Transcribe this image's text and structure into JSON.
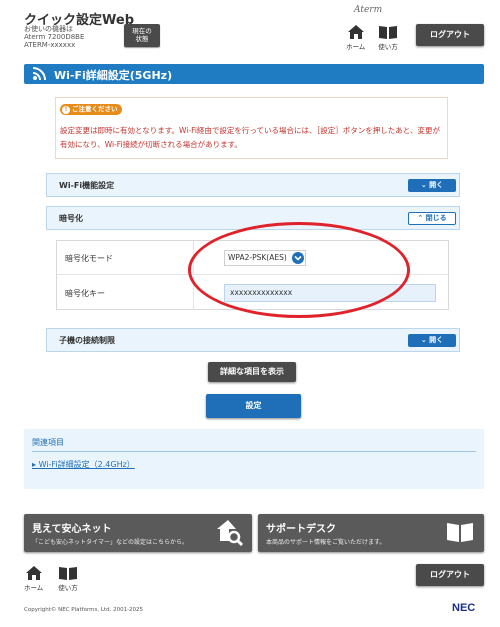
{
  "header": {
    "app_title": "クイック設定Web",
    "device_line1": "お使いの機器は",
    "device_line2": "Aterm 7200D8BE",
    "device_line3": "ATERM-xxxxxx",
    "status_line1": "現在の",
    "status_line2": "状態",
    "brand": "Aterm",
    "home_label": "ホーム",
    "help_label": "使い方",
    "logout_label": "ログアウト"
  },
  "page": {
    "title": "Wi-Fi詳細設定(5GHz)"
  },
  "notice": {
    "badge": "ご注意ください",
    "text": "設定変更は即時に有効となります。Wi-Fi経由で設定を行っている場合には、［設定］ボタンを押したあと、変更が有効になり、Wi-Fi接続が切断される場合があります。"
  },
  "sections": {
    "wifi_function": {
      "label": "Wi-Fi機能設定",
      "toggle": "開く"
    },
    "encryption": {
      "label": "暗号化",
      "toggle": "閉じる"
    },
    "client_limit": {
      "label": "子機の接続制限",
      "toggle": "開く"
    }
  },
  "encryption": {
    "mode_label": "暗号化モード",
    "mode_value": "WPA2-PSK(AES)",
    "key_label": "暗号化キー",
    "key_value": "xxxxxxxxxxxxxx"
  },
  "buttons": {
    "show_details": "詳細な項目を表示",
    "apply": "設定"
  },
  "related": {
    "heading": "関連項目",
    "link": "Wi-Fi詳細設定（2.4GHz）"
  },
  "promos": {
    "safety": {
      "title": "見えて安心ネット",
      "desc": "「こども安心ネットタイマー」などの設定はこちらから。"
    },
    "support": {
      "title": "サポートデスク",
      "desc": "本商品のサポート情報をご覧いただけます。"
    }
  },
  "footer": {
    "home_label": "ホーム",
    "help_label": "使い方",
    "logout_label": "ログアウト",
    "copyright": "Copyright© NEC Platforms, Ltd. 2001-2025",
    "logo": "NEC"
  },
  "colors": {
    "accent": "#1f7bc2",
    "warning": "#c4322d",
    "annotation": "#e0232a"
  }
}
